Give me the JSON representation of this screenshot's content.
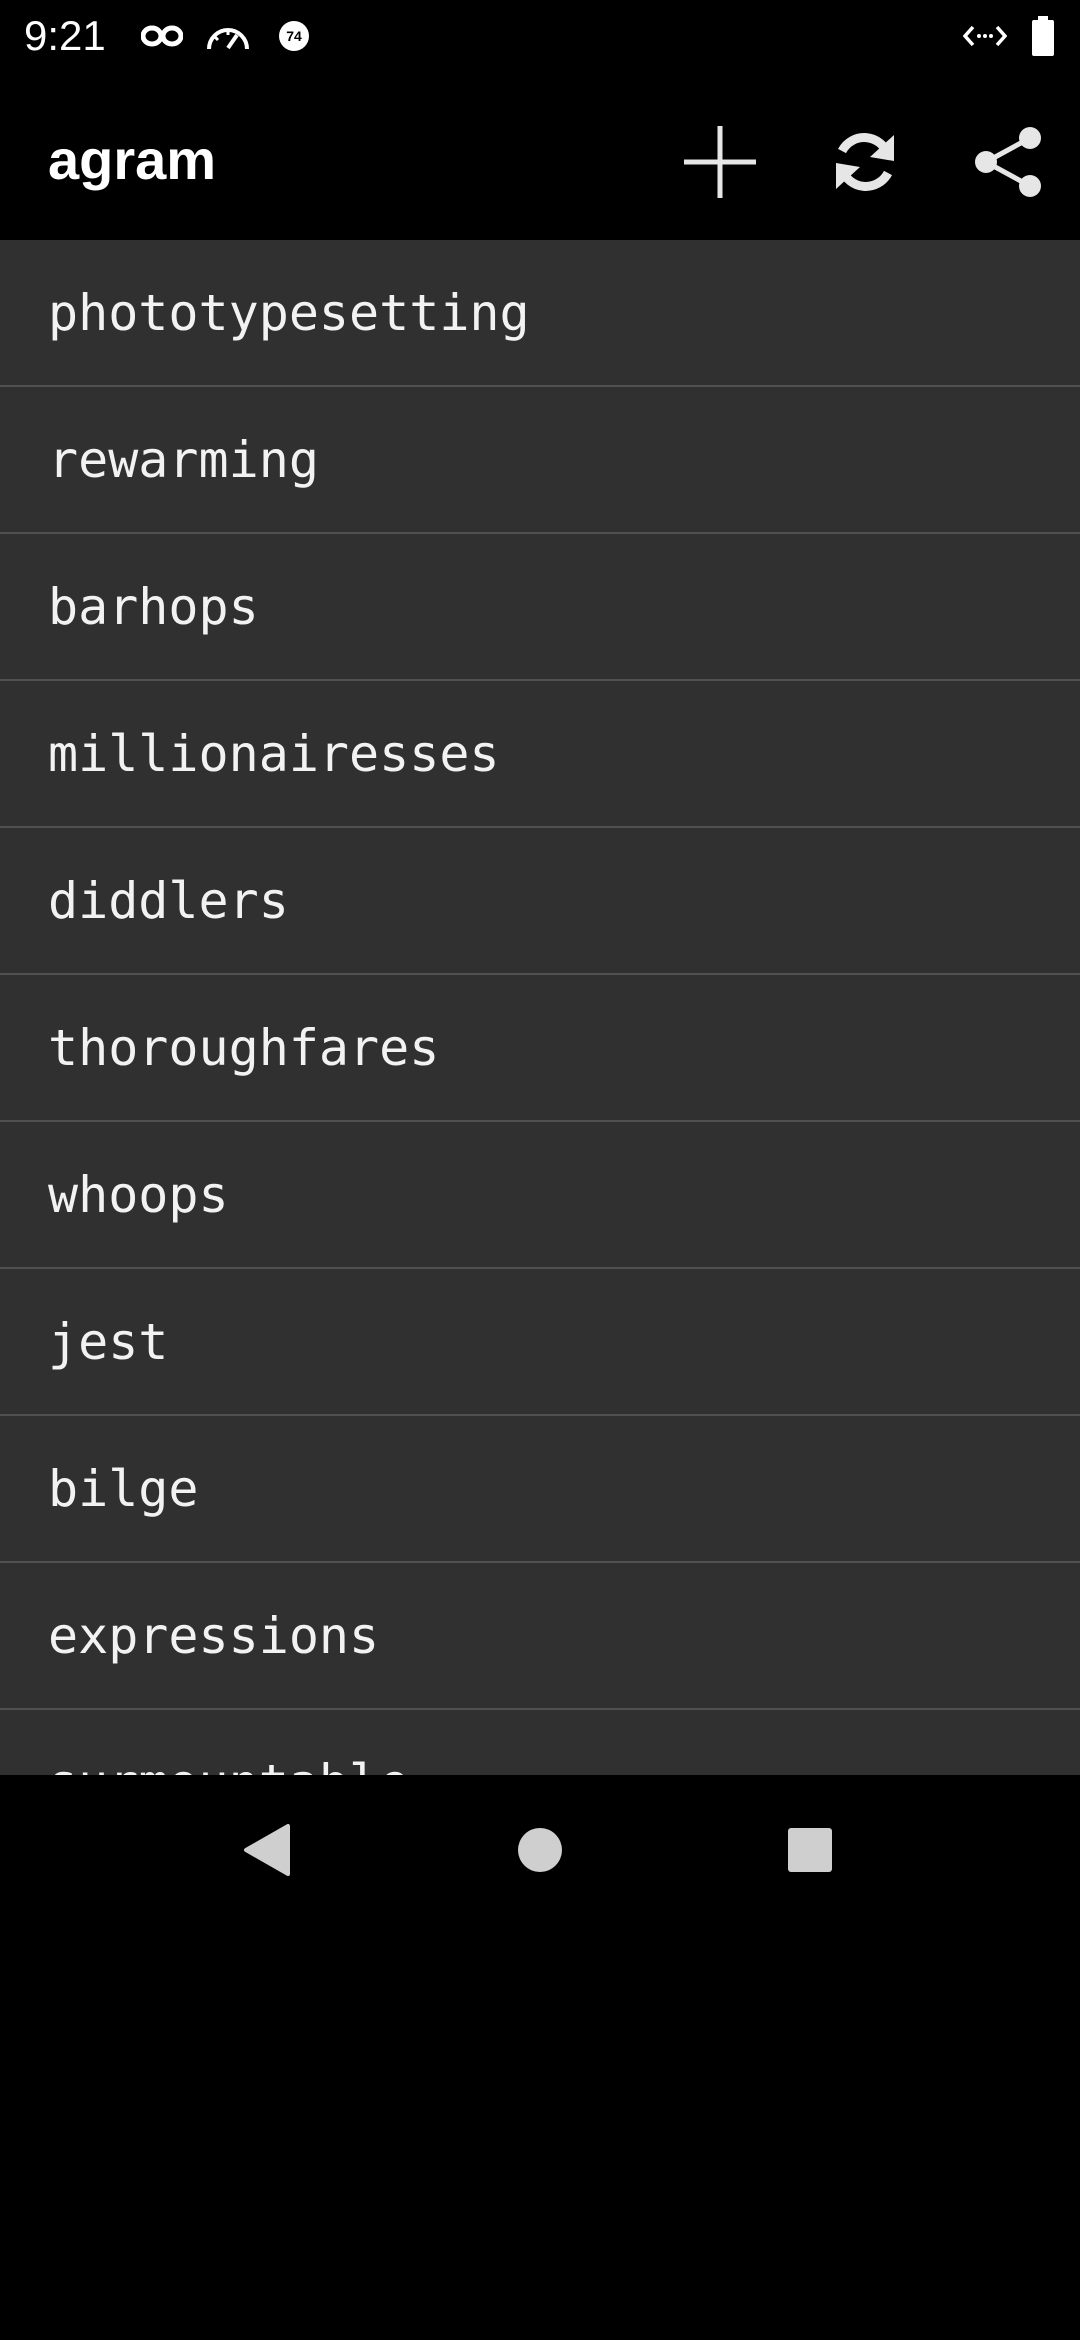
{
  "status_bar": {
    "time": "9:21",
    "icons": [
      "infinity-icon",
      "speedometer-icon",
      "badge-74-icon",
      "code-arrows-icon",
      "battery-icon"
    ],
    "badge_text": "74"
  },
  "app_bar": {
    "title": "agram",
    "actions": [
      "add-icon",
      "refresh-icon",
      "share-icon"
    ]
  },
  "list": {
    "items": [
      "phototypesetting",
      "rewarming",
      "barhops",
      "millionairesses",
      "diddlers",
      "thoroughfares",
      "whoops",
      "jest",
      "bilge",
      "expressions",
      "surmountable"
    ]
  },
  "nav_bar": {
    "buttons": [
      "back-icon",
      "home-icon",
      "recents-icon"
    ]
  },
  "colors": {
    "background": "#000000",
    "list_background": "#303030",
    "divider": "#505050",
    "text": "#f2f2f2"
  }
}
